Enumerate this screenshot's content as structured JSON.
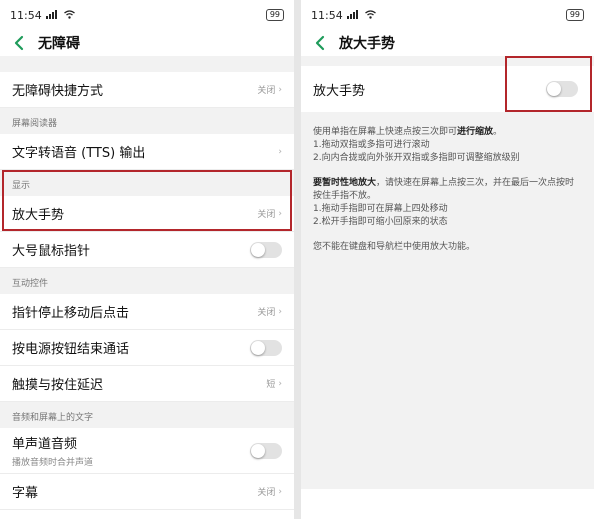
{
  "status": {
    "time": "11:54",
    "battery": "99"
  },
  "left": {
    "title": "无障碍",
    "row_shortcut": {
      "label": "无障碍快捷方式",
      "value": "关闭"
    },
    "section_reader": "屏幕阅读器",
    "row_tts": {
      "label": "文字转语音 (TTS) 输出"
    },
    "section_display": "显示",
    "row_magnify": {
      "label": "放大手势",
      "value": "关闭"
    },
    "row_pointer": {
      "label": "大号鼠标指针"
    },
    "section_interaction": "互动控件",
    "row_dwell": {
      "label": "指针停止移动后点击",
      "value": "关闭"
    },
    "row_power": {
      "label": "按电源按钮结束通话"
    },
    "row_touch_delay": {
      "label": "触摸与按住延迟",
      "value": "短"
    },
    "section_audio": "音频和屏幕上的文字",
    "row_mono": {
      "label": "单声道音频",
      "sub": "播放音频时合并声道"
    },
    "row_captions": {
      "label": "字幕",
      "value": "关闭"
    }
  },
  "right": {
    "title": "放大手势",
    "row_label": "放大手势",
    "p1_prefix": "使用单指在屏幕上快速点按三次即可",
    "p1_bold": "进行缩放",
    "p1_suffix": "。",
    "p1_line2": "1.拖动双指或多指可进行滚动",
    "p1_line3": "2.向内合拢或向外张开双指或多指即可调整缩放级别",
    "p2_bold": "要暂时性地放大",
    "p2_text": "，请快速在屏幕上点按三次，并在最后一次点按时按住手指不放。",
    "p2_line2": "1.拖动手指即可在屏幕上四处移动",
    "p2_line3": "2.松开手指即可缩小回原来的状态",
    "p3": "您不能在键盘和导航栏中使用放大功能。"
  },
  "colors": {
    "highlight": "#b3262b",
    "accent": "#1e9b5a"
  }
}
